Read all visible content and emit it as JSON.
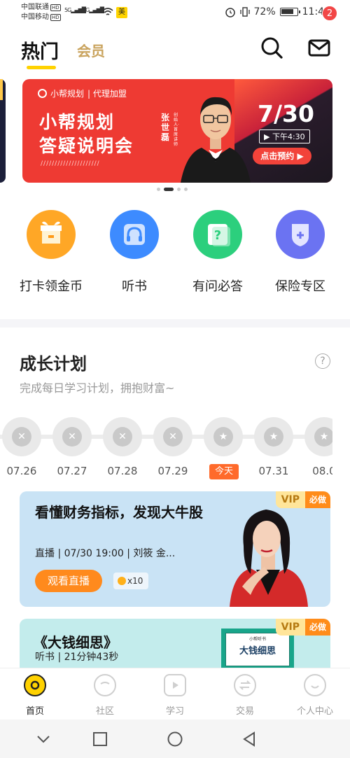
{
  "status_bar": {
    "carrier1": "中国联通",
    "carrier2": "中国移动",
    "hd": "HD",
    "net1": "5G",
    "net2": "4G",
    "app_badge": "美",
    "battery_pct": "72%",
    "time": "11:40"
  },
  "header": {
    "tab_hot": "热门",
    "tab_vip": "会员",
    "mail_badge_count": "2"
  },
  "banner": {
    "brand": "小帮规划",
    "brand_suffix": "| 代理加盟",
    "line1": "小帮规划",
    "line2": "答疑说明会",
    "speaker_name": "张世磊",
    "speaker_title": "创始人·首席讲师",
    "date": "7/30",
    "time": "下午4:30",
    "cta": "点击预约",
    "dots_total": 4,
    "dots_active": 1
  },
  "quick_actions": [
    {
      "label": "打卡领金币",
      "color": "#ffa726"
    },
    {
      "label": "听书",
      "color": "#3d8bff"
    },
    {
      "label": "有问必答",
      "color": "#2ccf7d"
    },
    {
      "label": "保险专区",
      "color": "#6b73f2"
    }
  ],
  "plan": {
    "title": "成长计划",
    "help": "?",
    "subtitle": "完成每日学习计划，拥抱财富~",
    "days": [
      "07.26",
      "07.27",
      "07.28",
      "07.29",
      "今天",
      "07.31",
      "08.0"
    ],
    "today_index": 4
  },
  "cards": [
    {
      "title": "看懂财务指标，发现大牛股",
      "meta": "直播 | 07/30 19:00 | 刘筱 金...",
      "button": "观看直播",
      "coins": "x10",
      "vip": "VIP",
      "must": "必做"
    },
    {
      "title": "《大钱细思》",
      "meta": "听书 | 21分钟43秒",
      "vip": "VIP",
      "must": "必做",
      "book_small": "小帮听书",
      "book_title": "大钱细思"
    }
  ],
  "bottom_nav": [
    {
      "label": "首页",
      "icon": "home-icon",
      "active": true
    },
    {
      "label": "社区",
      "icon": "community-icon",
      "active": false
    },
    {
      "label": "学习",
      "icon": "study-icon",
      "active": false
    },
    {
      "label": "交易",
      "icon": "trade-icon",
      "active": false
    },
    {
      "label": "个人中心",
      "icon": "profile-icon",
      "active": false
    }
  ]
}
